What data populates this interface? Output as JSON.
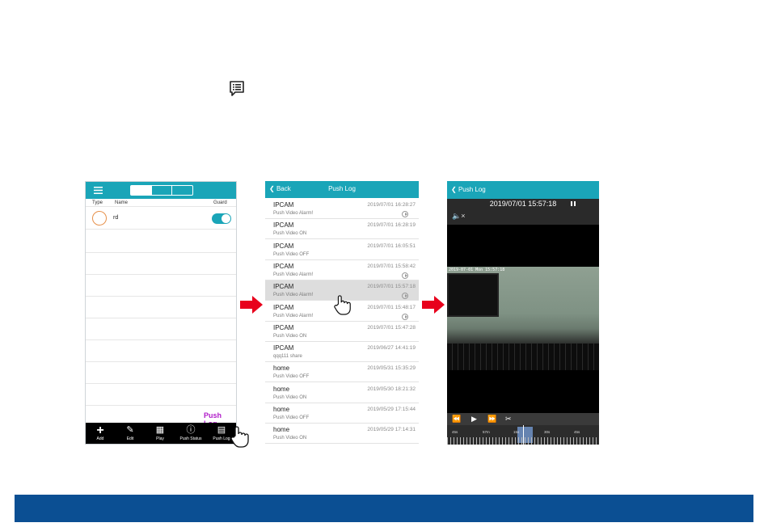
{
  "colors": {
    "accent": "#1aa5b8",
    "arrow": "#e8001c",
    "push_log_label": "#b01cc9",
    "footer": "#0b4f93",
    "selected_row": "#dddddd"
  },
  "header_icon": "push-log-icon",
  "phone1": {
    "columns": {
      "type": "Type",
      "name": "Name",
      "guard": "Guard"
    },
    "device": {
      "name": "rd",
      "guard_on": true
    },
    "push_log_label": "Push Log",
    "tabs": [
      {
        "label": "Add",
        "icon": "plus-icon"
      },
      {
        "label": "Edit",
        "icon": "pencil-circle-icon"
      },
      {
        "label": "Play",
        "icon": "grid-play-icon"
      },
      {
        "label": "Push Status",
        "icon": "alert-bubble-icon"
      },
      {
        "label": "Push Log",
        "icon": "push-log-icon"
      }
    ]
  },
  "phone2": {
    "back": "Back",
    "title": "Push Log",
    "entries": [
      {
        "name": "IPCAM",
        "desc": "Push Video Alarm!",
        "time": "2019/07/01 16:28:27",
        "play": true
      },
      {
        "name": "IPCAM",
        "desc": "Push Video ON",
        "time": "2019/07/01 16:28:19",
        "play": false
      },
      {
        "name": "IPCAM",
        "desc": "Push Video OFF",
        "time": "2019/07/01 16:05:51",
        "play": false
      },
      {
        "name": "IPCAM",
        "desc": "Push Video Alarm!",
        "time": "2019/07/01 15:58:42",
        "play": true
      },
      {
        "name": "IPCAM",
        "desc": "Push Video Alarm!",
        "time": "2019/07/01 15:57:18",
        "play": true,
        "selected": true
      },
      {
        "name": "IPCAM",
        "desc": "Push Video Alarm!",
        "time": "2019/07/01 15:48:17",
        "play": true
      },
      {
        "name": "IPCAM",
        "desc": "Push Video ON",
        "time": "2019/07/01 15:47:28",
        "play": false
      },
      {
        "name": "IPCAM",
        "desc": "qqq111 share",
        "time": "2019/06/27 14:41:19",
        "play": false
      },
      {
        "name": "home",
        "desc": "Push Video OFF",
        "time": "2019/05/31 15:35:29",
        "play": false
      },
      {
        "name": "home",
        "desc": "Push Video ON",
        "time": "2019/05/30 18:21:32",
        "play": false
      },
      {
        "name": "home",
        "desc": "Push Video OFF",
        "time": "2019/05/29 17:15:44",
        "play": false
      },
      {
        "name": "home",
        "desc": "Push Video ON",
        "time": "2019/05/29 17:14:31",
        "play": false
      }
    ]
  },
  "phone3": {
    "back": "Push Log",
    "timestamp": "2019/07/01 15:57:18",
    "osd": "2019-07-01 Mon 15:57:18",
    "timeline_labels": [
      "45s",
      "57m",
      "15s",
      "30s",
      "45s"
    ]
  }
}
